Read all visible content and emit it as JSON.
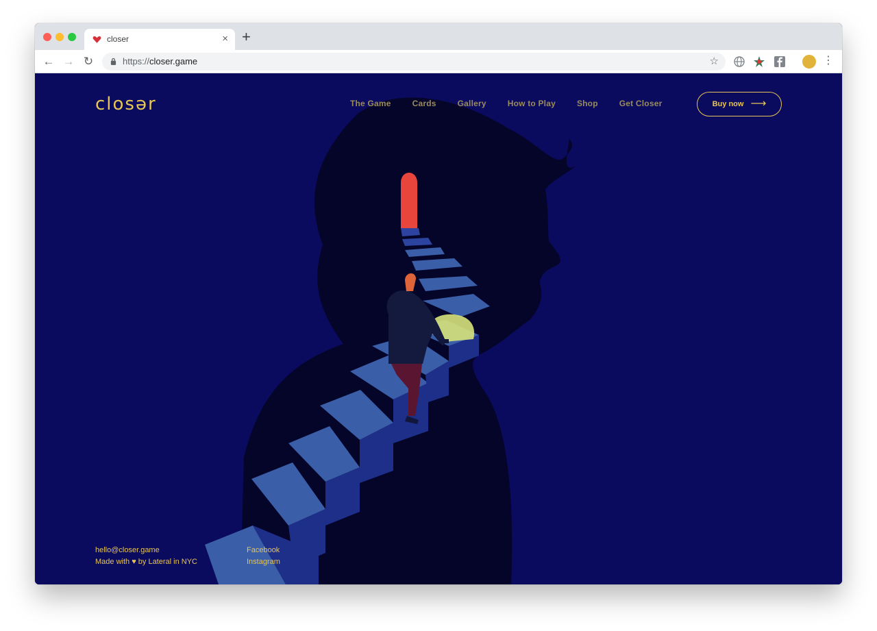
{
  "browser": {
    "tab_title": "closer",
    "tab_close": "×",
    "new_tab": "+",
    "url_scheme": "https://",
    "url_host": "closer.game",
    "back": "←",
    "forward": "→",
    "reload": "↻",
    "bookmark": "☆",
    "menu": "⋮"
  },
  "site": {
    "logo": "closər",
    "nav": [
      "The Game",
      "Cards",
      "Gallery",
      "How to Play",
      "Shop",
      "Get Closer"
    ],
    "buy_label": "Buy now",
    "buy_arrow": "⟶",
    "footer": {
      "email": "hello@closer.game",
      "made_prefix": "Made with",
      "made_heart": "♥",
      "made_suffix": "by Lateral in NYC",
      "links": [
        "Facebook",
        "Instagram"
      ]
    }
  },
  "colors": {
    "background": "#0a0a5f",
    "accent": "#e7c655",
    "nav_text": "#9a8c5b",
    "silhouette": "#05052a",
    "stairs_light": "#3b5ea8",
    "stairs_mid": "#1e2f8a",
    "door": "#e8453c",
    "lamp": "#d7e27a"
  },
  "icons": {
    "favicon": "heart-icon",
    "lock": "lock-icon",
    "star": "star-icon",
    "ext1": "globe-icon",
    "ext2": "puzzle-icon",
    "ext3": "facebook-icon"
  }
}
